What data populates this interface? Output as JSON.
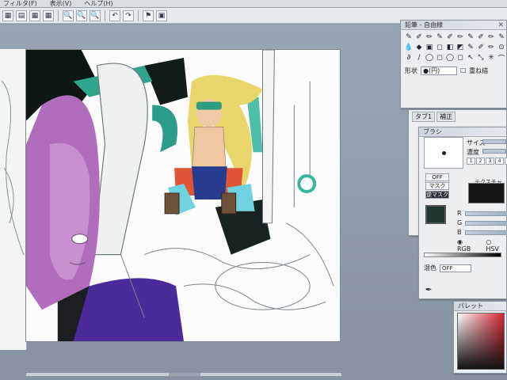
{
  "menubar": {
    "items": [
      "フィルタ(F)",
      "表示(V)",
      "ヘルプ(H)"
    ]
  },
  "toolbar": {
    "buttons": [
      {
        "icon": "grid-icon",
        "glyph": "▦"
      },
      {
        "icon": "layer-icon",
        "glyph": "▤"
      },
      {
        "icon": "grid2-icon",
        "glyph": "▦"
      },
      {
        "icon": "grid3-icon",
        "glyph": "▦"
      },
      {
        "icon": "zoom-in-icon",
        "glyph": "🔍"
      },
      {
        "icon": "zoom-out-icon",
        "glyph": "🔍"
      },
      {
        "icon": "zoom-fit-icon",
        "glyph": "🔍"
      },
      {
        "icon": "undo-icon",
        "glyph": "↶"
      },
      {
        "icon": "redo-icon",
        "glyph": "↷"
      },
      {
        "icon": "stamp-icon",
        "glyph": "⚑"
      },
      {
        "icon": "flag-icon",
        "glyph": "▣"
      }
    ]
  },
  "pen_panel": {
    "title": "鉛筆 - 自由線",
    "close": "✕",
    "tools_row1": [
      "✎",
      "✐",
      "✏",
      "✎",
      "✐",
      "✏",
      "✎",
      "✐",
      "✏",
      "✎"
    ],
    "tools_row2": [
      "💧",
      "◆",
      "▣",
      "◻",
      "◧",
      "◩",
      "✎",
      "✐",
      "✏",
      "⊙"
    ],
    "tools_row3": [
      "∂",
      "/",
      "◯",
      "◻",
      "◯",
      "◻",
      "↖",
      "⤡",
      "✳",
      "⌒"
    ],
    "shape_label": "形状",
    "shape_value": "●(円)",
    "check_label": "重ね描"
  },
  "tab_panel": {
    "tabs": [
      "タブ1",
      "補正"
    ]
  },
  "color_panel": {
    "title": "ブラシ",
    "size_label": "サイズ",
    "density_label": "濃度",
    "numbers": [
      "1",
      "2",
      "3",
      "4",
      "5"
    ],
    "mask_off": "OFF",
    "mask_on": "マスク",
    "mask_inverse": "逆マスク",
    "texture_label": "テクスチャ",
    "r_label": "R",
    "g_label": "G",
    "b_label": "B",
    "rgb_label": "RGB",
    "hsv_label": "HSV",
    "hi_label": "混色",
    "hi_value": "OFF",
    "swatch_color": "#1e3530"
  },
  "palette_panel": {
    "title": "パレット"
  },
  "canvas": {
    "alt": "illustration"
  }
}
